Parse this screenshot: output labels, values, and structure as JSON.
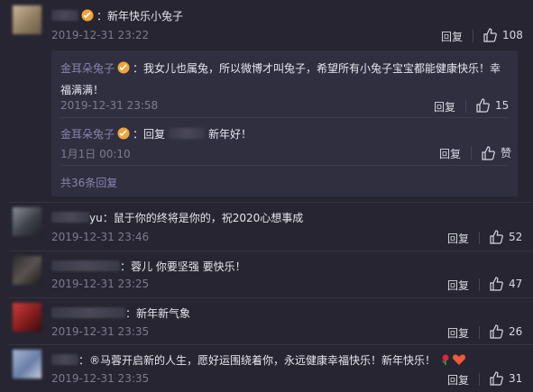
{
  "comments": [
    {
      "text": "：新年快乐小兔子",
      "time": "2019-12-31 23:22",
      "reply": "回复",
      "likes": "108"
    },
    {
      "text": "yu：鼠于你的终将是你的，祝2020心想事成",
      "time": "2019-12-31 23:46",
      "reply": "回复",
      "likes": "52"
    },
    {
      "text": "：蓉儿 你要坚强 要快乐！",
      "time": "2019-12-31 23:25",
      "reply": "回复",
      "likes": "47"
    },
    {
      "text": "：新年新气象",
      "time": "2019-12-31 23:35",
      "reply": "回复",
      "likes": "26"
    },
    {
      "text": "：®马蓉开启新的人生，愿好运围绕着你，永远健康幸福快乐！新年快乐！",
      "time": "2019-12-31 23:35",
      "reply": "回复",
      "likes": "31"
    }
  ],
  "subreplies": [
    {
      "name": "金耳朵兔子",
      "text_line1": "：我女儿也属兔，所以微博才叫兔子，希望所有小兔子宝宝都能健康快乐！幸",
      "text_line2": "福满满！",
      "time": "2019-12-31 23:58",
      "reply": "回复",
      "likes": "15"
    },
    {
      "name": "金耳朵兔子",
      "text_pre": "：回复",
      "text_post": "新年好！",
      "time": "1月1日 00:10",
      "reply": "回复",
      "likes": "赞"
    }
  ],
  "more_replies": "共36条回复",
  "colors": {
    "background": "#262531",
    "panel": "#302f40",
    "username": "#8a84ad",
    "muted": "#7d7b8e"
  }
}
